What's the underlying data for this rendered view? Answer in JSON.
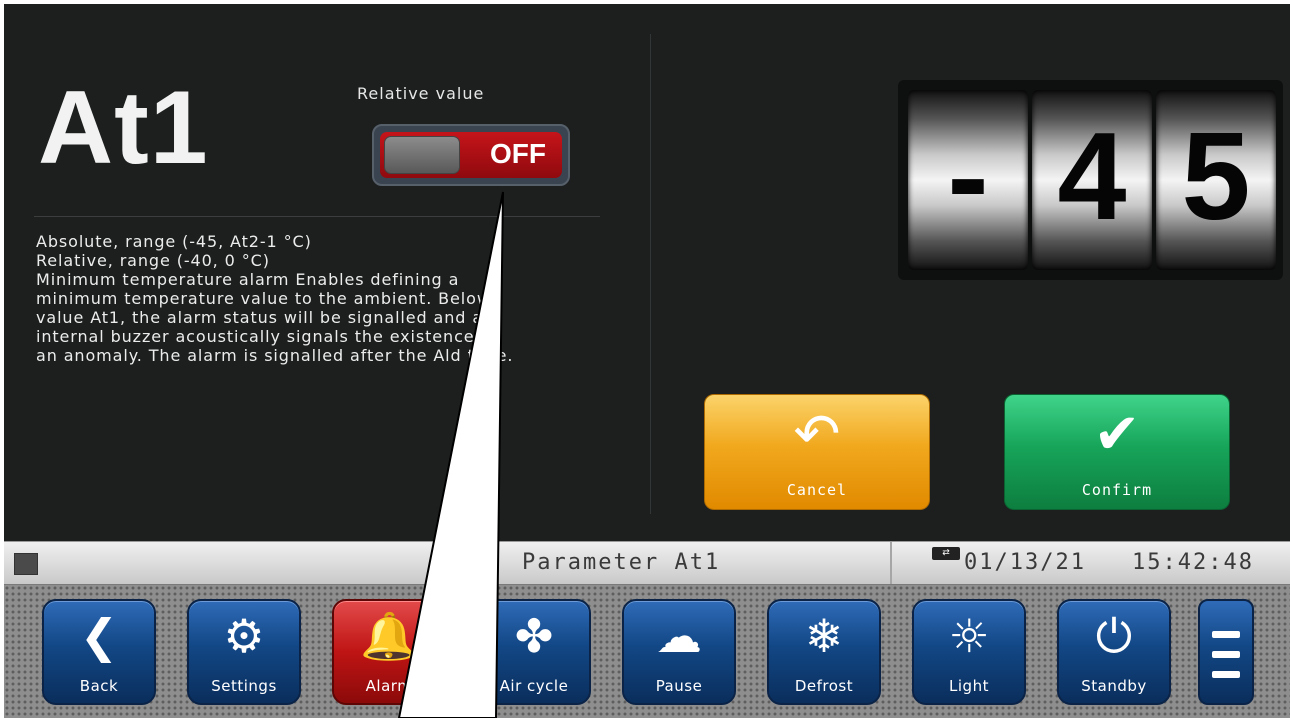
{
  "param": {
    "name": "At1",
    "relative_label": "Relative value",
    "toggle_state": "OFF"
  },
  "description": [
    "Absolute, range (-45, At2-1 °C)",
    "Relative, range (-40, 0 °C)",
    "Minimum temperature alarm Enables defining a",
    "minimum temperature value to the ambient. Below",
    "value At1, the alarm status will be signalled and an",
    "internal buzzer acoustically signals the existence of",
    "an anomaly. The alarm is signalled after the Ald time."
  ],
  "value": {
    "d1": "-",
    "d2": "4",
    "d3": "5"
  },
  "actions": {
    "cancel_label": "Cancel",
    "confirm_label": "Confirm"
  },
  "status": {
    "title": "Parameter At1",
    "usb_icon": "usb-icon",
    "date": "01/13/21",
    "time": "15:42:48"
  },
  "nav": {
    "back": "Back",
    "settings": "Settings",
    "alarm": "Alarm",
    "air_cycle": "Air cycle",
    "pause": "Pause",
    "defrost": "Defrost",
    "light": "Light",
    "standby": "Standby"
  },
  "colors": {
    "toggle_off": "#c5141a",
    "cancel": "#f1a81d",
    "confirm": "#17a55a",
    "nav": "#124785",
    "alarm": "#bf1414"
  }
}
